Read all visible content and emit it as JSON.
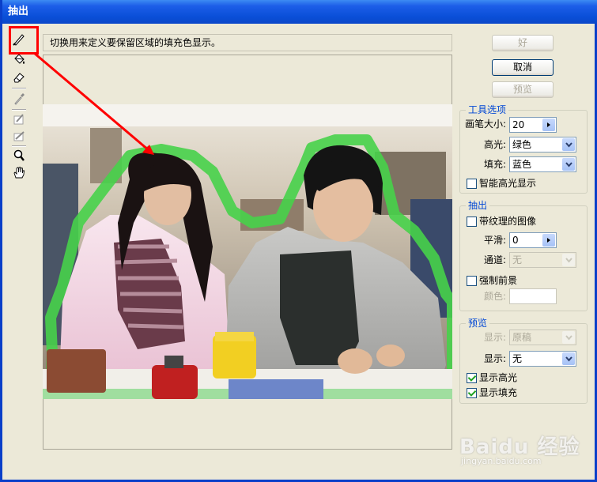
{
  "window": {
    "title": "抽出"
  },
  "hint": {
    "text": "切换用来定义要保留区域的填充色显示。"
  },
  "buttons": {
    "ok": "好",
    "cancel": "取消",
    "preview": "预览"
  },
  "tool_options": {
    "title": "工具选项",
    "brush_size_label": "画笔大小:",
    "brush_size_value": "20",
    "highlight_label": "高光:",
    "highlight_value": "绿色",
    "fill_label": "填充:",
    "fill_value": "蓝色",
    "smart_highlight_label": "智能高光显示",
    "smart_highlight_checked": false
  },
  "extraction": {
    "title": "抽出",
    "textured_label": "带纹理的图像",
    "textured_checked": false,
    "smooth_label": "平滑:",
    "smooth_value": "0",
    "channel_label": "通道:",
    "channel_value": "无",
    "force_fg_label": "强制前景",
    "force_fg_checked": false,
    "color_label": "颜色:"
  },
  "preview_group": {
    "title": "预览",
    "show1_label": "显示:",
    "show1_value": "原稿",
    "show2_label": "显示:",
    "show2_value": "无",
    "show_highlight_label": "显示高光",
    "show_highlight_checked": true,
    "show_fill_label": "显示填充",
    "show_fill_checked": true
  },
  "tools": [
    "edge-highlighter-icon",
    "fill-icon",
    "eraser-icon",
    "eyedropper-icon",
    "cleanup-icon",
    "edge-touchup-icon",
    "zoom-icon",
    "hand-icon"
  ],
  "colors": {
    "highlight": "#33cc33",
    "annotation": "#ff0000",
    "group_title": "#0046d5"
  },
  "watermark": {
    "logo": "Baidu 经验",
    "url": "jingyan.baidu.com"
  }
}
